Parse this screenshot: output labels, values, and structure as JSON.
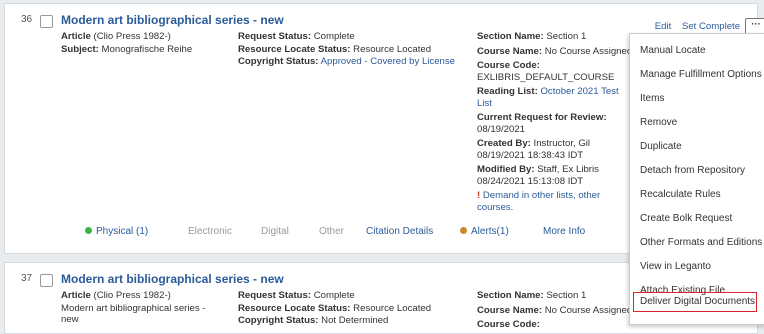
{
  "record1": {
    "number": "36",
    "title": "Modern art bibliographical series - new",
    "col1": {
      "type_label": "Article",
      "type_value": "(Clio Press 1982-)",
      "subject_label": "Subject:",
      "subject_value": "Monografische Reihe"
    },
    "col2": {
      "req_label": "Request Status:",
      "req_value": "Complete",
      "res_label": "Resource Locate Status:",
      "res_value": "Resource Located",
      "copy_label": "Copyright Status:",
      "copy_value": "Approved - Covered by License"
    },
    "col3": {
      "section_label": "Section Name:",
      "section_value": "Section 1",
      "course_label": "Course Name:",
      "course_value": "No Course Assigned",
      "code_label": "Course Code:",
      "code_value": "EXLIBRIS_DEFAULT_COURSE",
      "list_label": "Reading List:",
      "list_value": "October 2021 Test List",
      "review_label": "Current Request for Review:",
      "review_value": "08/19/2021",
      "created_label": "Created By:",
      "created_value": "Instructor, Gil 08/19/2021 18:38:43 IDT",
      "modified_label": "Modified By:",
      "modified_value": "Staff, Ex Libris 08/24/2021 15:13:08 IDT",
      "demand_icon": "!",
      "demand_text": "Demand in other lists, other courses."
    },
    "tabs": {
      "physical": "Physical (1)",
      "electronic": "Electronic",
      "digital": "Digital",
      "other": "Other",
      "citation": "Citation Details",
      "alerts": "Alerts(1)",
      "more": "More Info"
    }
  },
  "record2": {
    "number": "37",
    "title": "Modern art bibliographical series - new",
    "col1": {
      "type_label": "Article",
      "type_value": "(Clio Press 1982-)",
      "subtitle": "Modern art bibliographical series - new"
    },
    "col2": {
      "req_label": "Request Status:",
      "req_value": "Complete",
      "res_label": "Resource Locate Status:",
      "res_value": "Resource Located",
      "copy_label": "Copyright Status:",
      "copy_value": "Not Determined"
    },
    "col3": {
      "section_label": "Section Name:",
      "section_value": "Section 1",
      "course_label": "Course Name:",
      "course_value": "No Course Assigned",
      "code_label": "Course Code:"
    }
  },
  "actions": {
    "edit": "Edit",
    "set_complete": "Set Complete",
    "more": "···"
  },
  "menu": [
    "Manual Locate",
    "Manage Fulfillment Options",
    "Items",
    "Remove",
    "Duplicate",
    "Detach from Repository",
    "Recalculate Rules",
    "Create Bolk Request",
    "Other Formats and Editions",
    "View in Leganto",
    "Attach Existing File",
    "Deliver Digital Documents"
  ],
  "colors": {
    "link": "#2b5b99",
    "physical_dot": "#3bb44a",
    "alerts_dot": "#c98a2e",
    "warning": "#c0392b",
    "highlight": "#d9232e"
  }
}
